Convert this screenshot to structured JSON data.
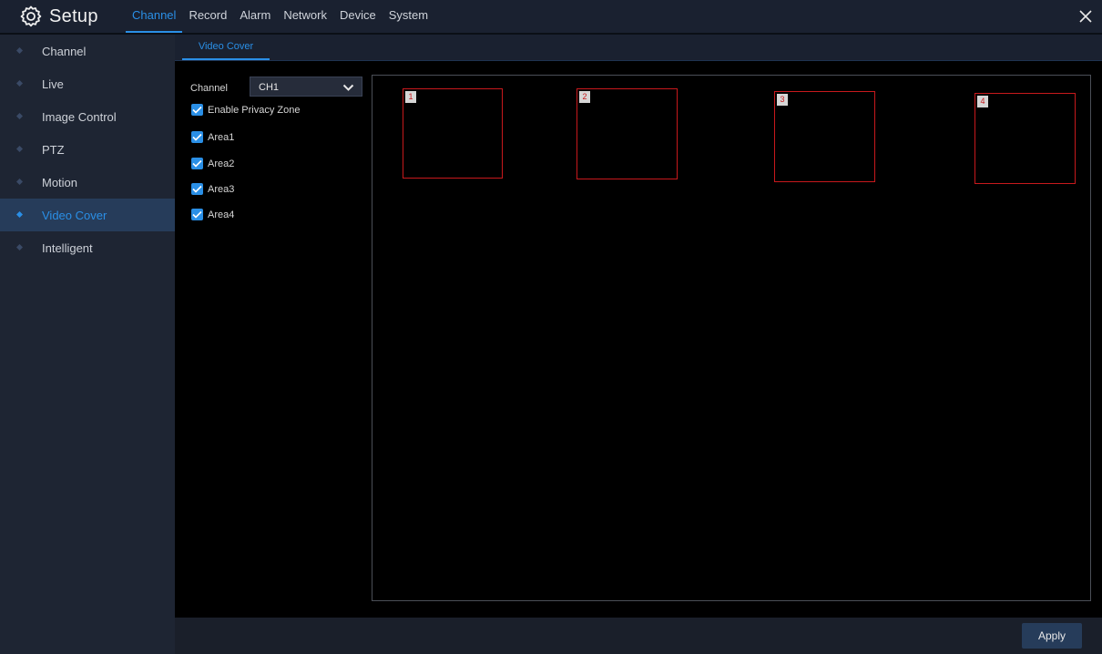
{
  "header": {
    "title": "Setup",
    "menu": [
      "Channel",
      "Record",
      "Alarm",
      "Network",
      "Device",
      "System"
    ],
    "active_menu": "Channel"
  },
  "sidebar": {
    "items": [
      {
        "label": "Channel"
      },
      {
        "label": "Live"
      },
      {
        "label": "Image Control"
      },
      {
        "label": "PTZ"
      },
      {
        "label": "Motion"
      },
      {
        "label": "Video Cover"
      },
      {
        "label": "Intelligent"
      }
    ],
    "active_item": "Video Cover"
  },
  "tabs": {
    "active": "Video Cover"
  },
  "controls": {
    "channel_label": "Channel",
    "channel_value": "CH1",
    "enable_privacy_zone": {
      "label": "Enable Privacy Zone",
      "checked": true
    },
    "areas": [
      {
        "label": "Area1",
        "checked": true
      },
      {
        "label": "Area2",
        "checked": true
      },
      {
        "label": "Area3",
        "checked": true
      },
      {
        "label": "Area4",
        "checked": true
      }
    ]
  },
  "zones": [
    {
      "number": "1"
    },
    {
      "number": "2"
    },
    {
      "number": "3"
    },
    {
      "number": "4"
    }
  ],
  "footer": {
    "apply_label": "Apply"
  },
  "colors": {
    "accent": "#2a8fe6",
    "zone_border": "#c8191c",
    "header_bg": "#1a2130",
    "sidebar_bg": "#1e2533",
    "active_bg": "#263c5a"
  },
  "icons": {
    "brand": "gear-icon",
    "close": "close-icon",
    "sidebar_bullet": "diamond-bullet-icon",
    "dropdown": "chevron-down-icon",
    "checkbox": "checkmark-icon"
  }
}
